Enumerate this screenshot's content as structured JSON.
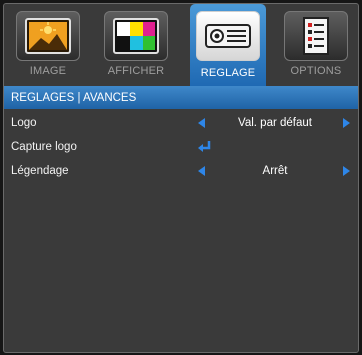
{
  "tabs": [
    {
      "label": "IMAGE",
      "icon": "image-icon",
      "active": false
    },
    {
      "label": "AFFICHER",
      "icon": "display-icon",
      "active": false
    },
    {
      "label": "REGLAGE",
      "icon": "projector-icon",
      "active": true
    },
    {
      "label": "OPTIONS",
      "icon": "options-icon",
      "active": false
    }
  ],
  "header": {
    "title": "REGLAGES | AVANCES"
  },
  "rows": [
    {
      "label": "Logo",
      "value": "Val. par défaut",
      "control": "selector"
    },
    {
      "label": "Capture logo",
      "value": "",
      "control": "enter"
    },
    {
      "label": "Légendage",
      "value": "Arrêt",
      "control": "selector"
    }
  ],
  "colors": {
    "accent": "#2e86e8",
    "tab_active": "#2f7cc4",
    "background": "#3a3a3a"
  }
}
